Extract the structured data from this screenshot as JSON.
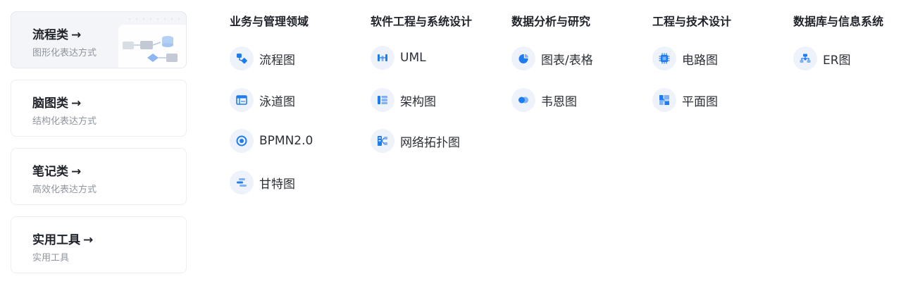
{
  "categories": [
    {
      "title": "流程类",
      "arrow": "→",
      "subtitle": "图形化表达方式"
    },
    {
      "title": "脑图类",
      "arrow": "→",
      "subtitle": "结构化表达方式"
    },
    {
      "title": "笔记类",
      "arrow": "→",
      "subtitle": "高效化表达方式"
    },
    {
      "title": "实用工具",
      "arrow": "→",
      "subtitle": "实用工具"
    }
  ],
  "columns": [
    {
      "title": "业务与管理领域",
      "items": [
        {
          "label": "流程图",
          "icon": "flowchart-icon"
        },
        {
          "label": "泳道图",
          "icon": "swimlane-icon"
        },
        {
          "label": "BPMN2.0",
          "icon": "bpmn-icon"
        },
        {
          "label": "甘特图",
          "icon": "gantt-icon"
        }
      ]
    },
    {
      "title": "软件工程与系统设计",
      "items": [
        {
          "label": "UML",
          "icon": "uml-icon"
        },
        {
          "label": "架构图",
          "icon": "architecture-icon"
        },
        {
          "label": "网络拓扑图",
          "icon": "network-topology-icon"
        }
      ]
    },
    {
      "title": "数据分析与研究",
      "items": [
        {
          "label": "图表/表格",
          "icon": "pie-chart-icon"
        },
        {
          "label": "韦恩图",
          "icon": "venn-icon"
        }
      ]
    },
    {
      "title": "工程与技术设计",
      "items": [
        {
          "label": "电路图",
          "icon": "chip-icon"
        },
        {
          "label": "平面图",
          "icon": "floorplan-icon"
        }
      ]
    },
    {
      "title": "数据库与信息系统",
      "items": [
        {
          "label": "ER图",
          "icon": "er-diagram-icon"
        }
      ]
    }
  ],
  "colors": {
    "accent": "#1f7cf0",
    "accent_light": "#7fb1f7",
    "icon_bg": "#eef2fb"
  }
}
